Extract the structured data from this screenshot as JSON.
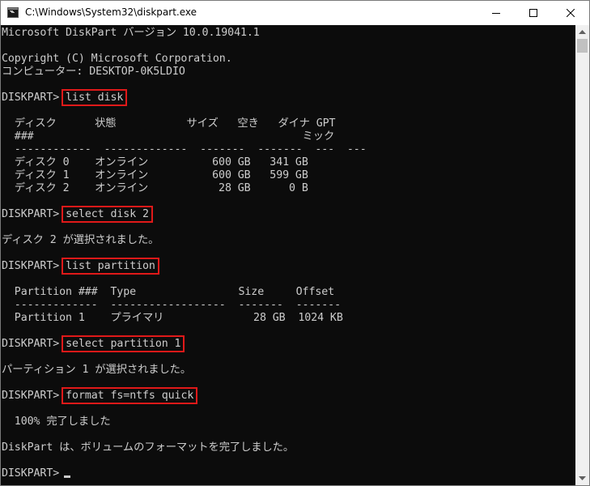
{
  "window": {
    "title": "C:\\Windows\\System32\\diskpart.exe"
  },
  "titlebar_buttons": {
    "minimize_icon": "minimize-icon",
    "maximize_icon": "maximize-icon",
    "close_icon": "close-icon"
  },
  "colors": {
    "console_background": "#0c0c0c",
    "console_text": "#cccccc",
    "highlight_box": "#e01919"
  },
  "console": {
    "prompt": "DISKPART>",
    "lines": [
      {
        "text": "Microsoft DiskPart バージョン 10.0.19041.1"
      },
      {
        "text": ""
      },
      {
        "text": "Copyright (C) Microsoft Corporation."
      },
      {
        "text": "コンピューター: DESKTOP-0K5LDIO"
      },
      {
        "text": ""
      },
      {
        "prompt": true,
        "command": "list disk"
      },
      {
        "text": ""
      },
      {
        "text": "  ディスク      状態           サイズ   空き   ダイナ GPT"
      },
      {
        "text": "  ###                                          ミック"
      },
      {
        "text": "  ------------  -------------  -------  -------  ---  ---"
      },
      {
        "text": "  ディスク 0    オンライン          600 GB   341 GB"
      },
      {
        "text": "  ディスク 1    オンライン          600 GB   599 GB"
      },
      {
        "text": "  ディスク 2    オンライン           28 GB      0 B"
      },
      {
        "text": ""
      },
      {
        "prompt": true,
        "command": "select disk 2"
      },
      {
        "text": ""
      },
      {
        "text": "ディスク 2 が選択されました。"
      },
      {
        "text": ""
      },
      {
        "prompt": true,
        "command": "list partition"
      },
      {
        "text": ""
      },
      {
        "text": "  Partition ###  Type                Size     Offset"
      },
      {
        "text": "  -------------  ------------------  -------  -------"
      },
      {
        "text": "  Partition 1    プライマリ              28 GB  1024 KB"
      },
      {
        "text": ""
      },
      {
        "prompt": true,
        "command": "select partition 1"
      },
      {
        "text": ""
      },
      {
        "text": "パーティション 1 が選択されました。"
      },
      {
        "text": ""
      },
      {
        "prompt": true,
        "command": "format fs=ntfs quick"
      },
      {
        "text": ""
      },
      {
        "text": "  100% 完了しました"
      },
      {
        "text": ""
      },
      {
        "text": "DiskPart は、ボリュームのフォーマットを完了しました。"
      },
      {
        "text": ""
      },
      {
        "prompt": true,
        "command": "",
        "cursor": true
      }
    ]
  }
}
